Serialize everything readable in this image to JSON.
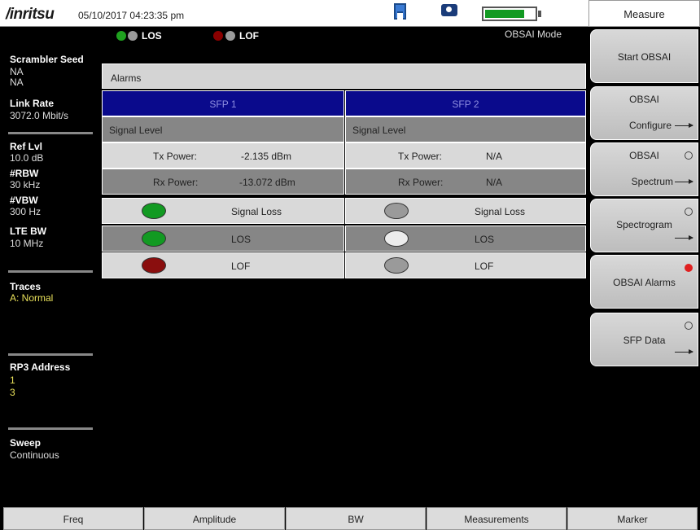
{
  "header": {
    "brand": "/inritsu",
    "datetime": "05/10/2017 04:23:35 pm",
    "battery_level": 0.78,
    "icons": [
      "save-icon",
      "camera-icon",
      "battery-icon"
    ]
  },
  "status": {
    "los_label": "LOS",
    "lof_label": "LOF",
    "mode": "OBSAI Mode",
    "los_colors": [
      "#1fa11f",
      "#9a9a9a"
    ],
    "lof_colors": [
      "#8a0000",
      "#9a9a9a"
    ]
  },
  "left_panel": {
    "scrambler_title": "Scrambler Seed",
    "scrambler_val1": "NA",
    "scrambler_val2": "NA",
    "link_rate_title": "Link Rate",
    "link_rate_val": "3072.0 Mbit/s",
    "ref_lvl_title": "Ref Lvl",
    "ref_lvl_val": "10.0 dB",
    "rbw_title": "#RBW",
    "rbw_val": "30 kHz",
    "vbw_title": "#VBW",
    "vbw_val": "300 Hz",
    "lte_bw_title": "LTE BW",
    "lte_bw_val": "10 MHz",
    "traces_title": "Traces",
    "traces_val": "A: Normal",
    "rp3_title": "RP3 Address",
    "rp3_val1": "1",
    "rp3_val2": "3",
    "sweep_title": "Sweep",
    "sweep_val": "Continuous"
  },
  "alarms": {
    "header": "Alarms",
    "sfp1": {
      "title": "SFP 1",
      "signal_level": "Signal Level",
      "tx_label": "Tx Power:",
      "tx_value": "-2.135 dBm",
      "rx_label": "Rx Power:",
      "rx_value": "-13.072 dBm",
      "signal_loss": "Signal Loss",
      "los": "LOS",
      "lof": "LOF",
      "led_colors": [
        "#129a22",
        "#129a22",
        "#8a0e0e"
      ]
    },
    "sfp2": {
      "title": "SFP 2",
      "signal_level": "Signal Level",
      "tx_label": "Tx Power:",
      "tx_value": "N/A",
      "rx_label": "Rx Power:",
      "rx_value": "N/A",
      "signal_loss": "Signal Loss",
      "los": "LOS",
      "lof": "LOF",
      "led_colors": [
        "#9a9a9a",
        "#ececec",
        "#9a9a9a"
      ]
    }
  },
  "softkeys": {
    "title": "Measure",
    "start_obsai": "Start OBSAI",
    "obsai_configure_l1": "OBSAI",
    "obsai_configure_l2": "Configure",
    "obsai_spectrum_l1": "OBSAI",
    "obsai_spectrum_l2": "Spectrum",
    "spectrogram": "Spectrogram",
    "obsai_alarms": "OBSAI Alarms",
    "sfp_data": "SFP Data",
    "active_color": "#e02020"
  },
  "bottom_bar": {
    "freq": "Freq",
    "amplitude": "Amplitude",
    "bw": "BW",
    "measurements": "Measurements",
    "marker": "Marker"
  }
}
